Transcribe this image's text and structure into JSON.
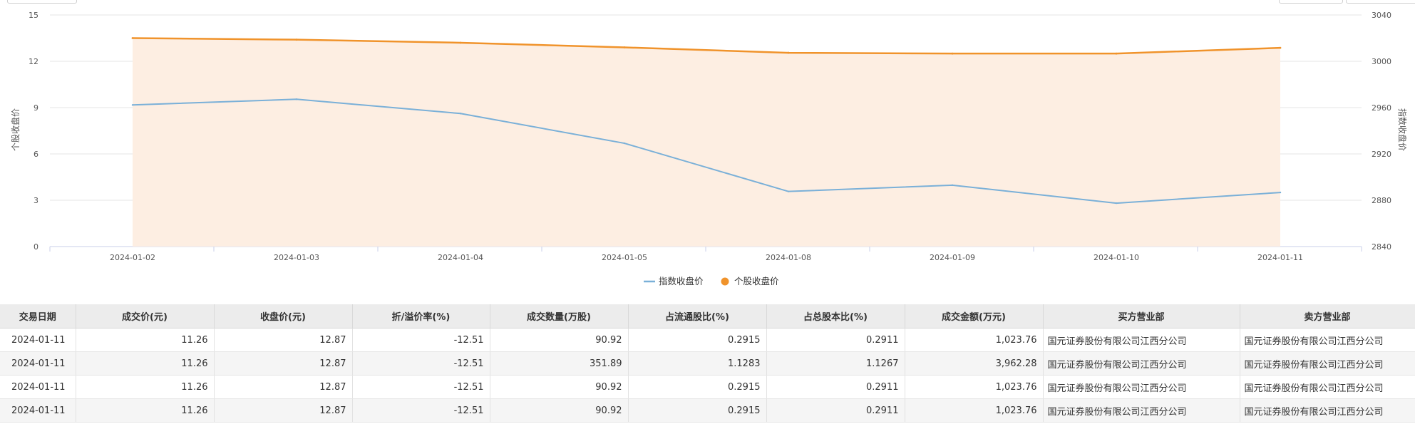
{
  "chart_data": {
    "type": "line",
    "categories": [
      "2024-01-02",
      "2024-01-03",
      "2024-01-04",
      "2024-01-05",
      "2024-01-08",
      "2024-01-09",
      "2024-01-10",
      "2024-01-11"
    ],
    "left_axis": {
      "label": "个股收盘价",
      "min": 0,
      "max": 15,
      "ticks": [
        "0",
        "3",
        "6",
        "9",
        "12",
        "15"
      ]
    },
    "right_axis": {
      "label": "指数收盘价",
      "min": 2840,
      "max": 3040,
      "ticks": [
        "2840",
        "2880",
        "2920",
        "2960",
        "3000",
        "3040"
      ]
    },
    "series": [
      {
        "name": "指数收盘价",
        "axis": "right",
        "color": "#7ab0d8",
        "values": [
          2962.3,
          2967.2,
          2954.9,
          2929.2,
          2887.6,
          2893.0,
          2877.5,
          2886.7
        ]
      },
      {
        "name": "个股收盘价",
        "axis": "left",
        "color": "#f0932b",
        "fill": "#fdeee2",
        "values": [
          13.5,
          13.4,
          13.2,
          12.9,
          12.55,
          12.5,
          12.5,
          12.87
        ]
      }
    ],
    "legend_position": "bottom-center",
    "grid": true
  },
  "table": {
    "headers": [
      "交易日期",
      "成交价(元)",
      "收盘价(元)",
      "折/溢价率(%)",
      "成交数量(万股)",
      "占流通股比(%)",
      "占总股本比(%)",
      "成交金额(万元)",
      "买方营业部",
      "卖方营业部"
    ],
    "rows": [
      [
        "2024-01-11",
        "11.26",
        "12.87",
        "-12.51",
        "90.92",
        "0.2915",
        "0.2911",
        "1,023.76",
        "国元证券股份有限公司江西分公司",
        "国元证券股份有限公司江西分公司"
      ],
      [
        "2024-01-11",
        "11.26",
        "12.87",
        "-12.51",
        "351.89",
        "1.1283",
        "1.1267",
        "3,962.28",
        "国元证券股份有限公司江西分公司",
        "国元证券股份有限公司江西分公司"
      ],
      [
        "2024-01-11",
        "11.26",
        "12.87",
        "-12.51",
        "90.92",
        "0.2915",
        "0.2911",
        "1,023.76",
        "国元证券股份有限公司江西分公司",
        "国元证券股份有限公司江西分公司"
      ],
      [
        "2024-01-11",
        "11.26",
        "12.87",
        "-12.51",
        "90.92",
        "0.2915",
        "0.2911",
        "1,023.76",
        "国元证券股份有限公司江西分公司",
        "国元证券股份有限公司江西分公司"
      ]
    ]
  }
}
